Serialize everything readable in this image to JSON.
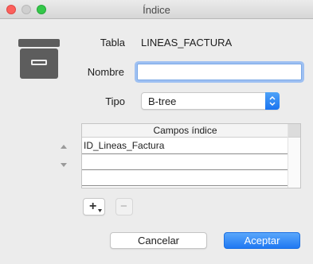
{
  "window": {
    "title": "Índice"
  },
  "form": {
    "table_label": "Tabla",
    "table_value": "LINEAS_FACTURA",
    "name_label": "Nombre",
    "name_value": "",
    "type_label": "Tipo",
    "type_value": "B-tree"
  },
  "fields_table": {
    "header": "Campos índice",
    "rows": [
      "ID_Lineas_Factura",
      "",
      "",
      ""
    ]
  },
  "buttons": {
    "add": "+",
    "remove": "−",
    "cancel": "Cancelar",
    "ok": "Aceptar"
  },
  "colors": {
    "accent": "#1f78f2",
    "focus_ring": "#9ec0f2"
  }
}
